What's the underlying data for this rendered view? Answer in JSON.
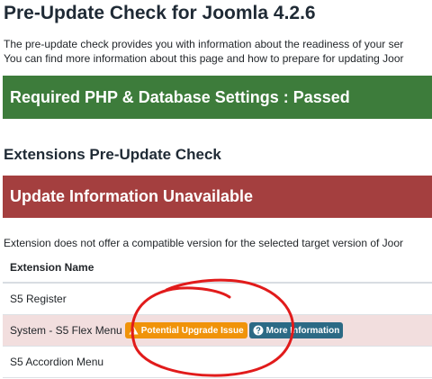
{
  "page": {
    "title": "Pre-Update Check for Joomla 4.2.6",
    "intro_line1": "The pre-update check provides you with information about the readiness of your ser",
    "intro_line2": "You can find more information about this page and how to prepare for updating Joor"
  },
  "php_banner": {
    "text": "Required PHP & Database Settings : Passed",
    "color": "#3d7c3b"
  },
  "extensions": {
    "section_title": "Extensions Pre-Update Check",
    "banner_text": "Update Information Unavailable",
    "banner_color": "#a43f3f",
    "description": "Extension does not offer a compatible version for the selected target version of Joor",
    "column_header": "Extension Name",
    "rows": [
      {
        "name": "S5 Register"
      },
      {
        "name": "System - S5 Flex Menu",
        "warning_label": "Potential Upgrade Issue",
        "warning_icon": "warning-triangle-icon",
        "info_label": "More Information",
        "info_icon": "question-circle-icon"
      },
      {
        "name": "S5 Accordion Menu"
      }
    ]
  },
  "colors": {
    "warning_badge": "#f0930a",
    "info_badge": "#2c6a85",
    "annotation_circle": "#e11b1b",
    "row_highlight": "#f2dede"
  }
}
